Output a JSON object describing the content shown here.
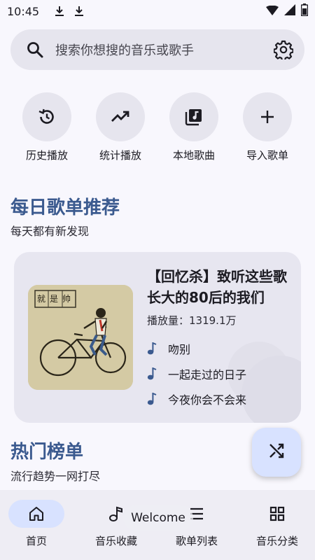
{
  "status_bar": {
    "time": "10:45",
    "icons": [
      "download-icon",
      "download-icon",
      "wifi-icon",
      "signal-icon",
      "battery-icon"
    ]
  },
  "search": {
    "placeholder": "搜索你想搜的音乐或歌手",
    "icon": "search-icon",
    "settings_icon": "gear-icon"
  },
  "quick_actions": [
    {
      "label": "历史播放",
      "icon": "history-icon"
    },
    {
      "label": "统计播放",
      "icon": "trending-icon"
    },
    {
      "label": "本地歌曲",
      "icon": "music-library-icon"
    },
    {
      "label": "导入歌单",
      "icon": "plus-icon"
    }
  ],
  "daily": {
    "title": "每日歌单推荐",
    "subtitle": "每天都有新发现",
    "playlist": {
      "title": "【回忆杀】致听这些歌长大的80后的我们",
      "play_count": "播放量：1319.1万",
      "cover_text": "就是帅",
      "songs": [
        "吻别",
        "一起走过的日子",
        "今夜你会不会来"
      ]
    }
  },
  "hot": {
    "title": "热门榜单",
    "subtitle": "流行趋势一网打尽"
  },
  "fab": {
    "icon": "shuffle-icon"
  },
  "bottom_nav": {
    "items": [
      {
        "label": "首页",
        "icon": "home-icon",
        "active": true
      },
      {
        "label": "音乐收藏",
        "icon": "music-note-icon",
        "active": false
      },
      {
        "label": "歌单列表",
        "icon": "list-icon",
        "active": false
      },
      {
        "label": "音乐分类",
        "icon": "grid-icon",
        "active": false
      }
    ]
  },
  "toast": "Welcome",
  "colors": {
    "accent": "#3b5a8f",
    "surface": "#e6e5ee",
    "fab": "#d8e2ff",
    "background": "#f8f7fd"
  }
}
